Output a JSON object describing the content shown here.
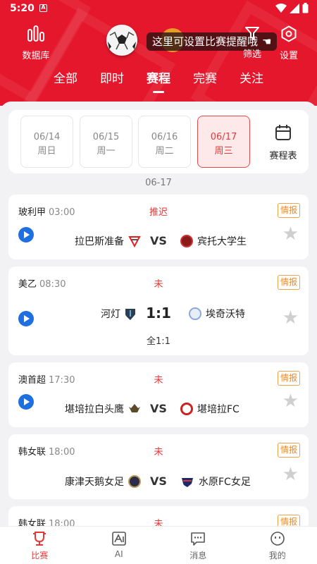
{
  "status_bar": {
    "time": "5:20",
    "app_badge": "A"
  },
  "header": {
    "database_label": "数据库",
    "filter_label": "筛选",
    "settings_label": "设置",
    "tooltip": "这里可设置比赛提醒哦",
    "tabs": [
      {
        "label": "全部"
      },
      {
        "label": "即时"
      },
      {
        "label": "赛程"
      },
      {
        "label": "完赛"
      },
      {
        "label": "关注"
      }
    ],
    "active_tab": "赛程",
    "brand_color": "#e5172c"
  },
  "dates": [
    {
      "date": "06/14",
      "weekday": "周日"
    },
    {
      "date": "06/15",
      "weekday": "周一"
    },
    {
      "date": "06/16",
      "weekday": "周二"
    },
    {
      "date": "06/17",
      "weekday": "周三"
    }
  ],
  "selected_date": "06/17",
  "schedule_label": "赛程表",
  "section_date": "06-17",
  "info_label": "情报",
  "vs_label": "VS",
  "matches": [
    {
      "league": "玻利甲",
      "time": "03:00",
      "status": "推迟",
      "home": "拉巴斯准备",
      "away": "宾托大学生",
      "has_video": true
    },
    {
      "league": "美乙",
      "time": "08:30",
      "status": "未",
      "home": "河灯",
      "away": "埃奇沃特",
      "score": "1:1",
      "full_time": "全1:1",
      "has_video": true
    },
    {
      "league": "澳首超",
      "time": "17:30",
      "status": "未",
      "home": "堪培拉白头鹰",
      "away": "堪培拉FC",
      "has_video": true
    },
    {
      "league": "韩女联",
      "time": "18:00",
      "status": "未",
      "home": "康津天鹅女足",
      "away": "水原FC女足",
      "has_video": false
    },
    {
      "league": "韩女联",
      "time": "18:00",
      "status": "未",
      "has_video": false
    }
  ],
  "bottom_nav": [
    {
      "label": "比赛",
      "icon": "trophy-icon",
      "active": true
    },
    {
      "label": "AI",
      "icon": "ai-chart-icon",
      "active": false
    },
    {
      "label": "消息",
      "icon": "message-icon",
      "active": false
    },
    {
      "label": "我的",
      "icon": "profile-icon",
      "active": false
    }
  ]
}
